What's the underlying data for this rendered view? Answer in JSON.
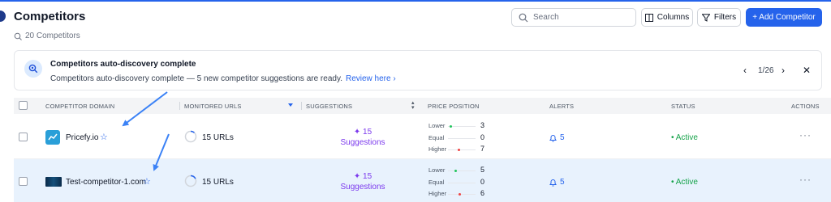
{
  "header": {
    "title": "Competitors",
    "count_label": "20 Competitors"
  },
  "toolbar": {
    "search_placeholder": "Search",
    "columns_label": "Columns",
    "filters_label": "Filters",
    "add_label": "+ Add Competitor"
  },
  "banner": {
    "title": "Competitors auto-discovery complete",
    "message": "Competitors auto-discovery complete — 5 new competitor suggestions are ready.",
    "link_label": "Review here ›",
    "pager": "1/26",
    "prev": "‹",
    "next": "›",
    "close": "✕"
  },
  "table": {
    "columns": [
      "COMPETITOR DOMAIN",
      "MONITORED URLS",
      "SUGGESTIONS",
      "PRICE POSITION",
      "ALERTS",
      "STATUS",
      "ACTIONS"
    ],
    "price_labels": [
      "Lower",
      "Equal",
      "Higher"
    ],
    "rows": [
      {
        "domain": "Pricefy.io",
        "urls": "15 URLs",
        "urls_progress": 0.12,
        "suggestions_count": "15",
        "suggestions_label": "Suggestions",
        "lower": "3",
        "equal": "0",
        "higher": "7",
        "alerts": "5",
        "status": "• Active",
        "actions": "···"
      },
      {
        "domain": "Test-competitor-1.com",
        "urls": "15 URLs",
        "urls_progress": 0.18,
        "suggestions_count": "15",
        "suggestions_label": "Suggestions",
        "lower": "5",
        "equal": "0",
        "higher": "6",
        "alerts": "5",
        "status": "• Active",
        "actions": "···"
      }
    ]
  },
  "colors": {
    "accent": "#2563eb",
    "active": "#16a34a",
    "suggestions": "#7c3aed",
    "selected_row": "#e8f2fd"
  }
}
